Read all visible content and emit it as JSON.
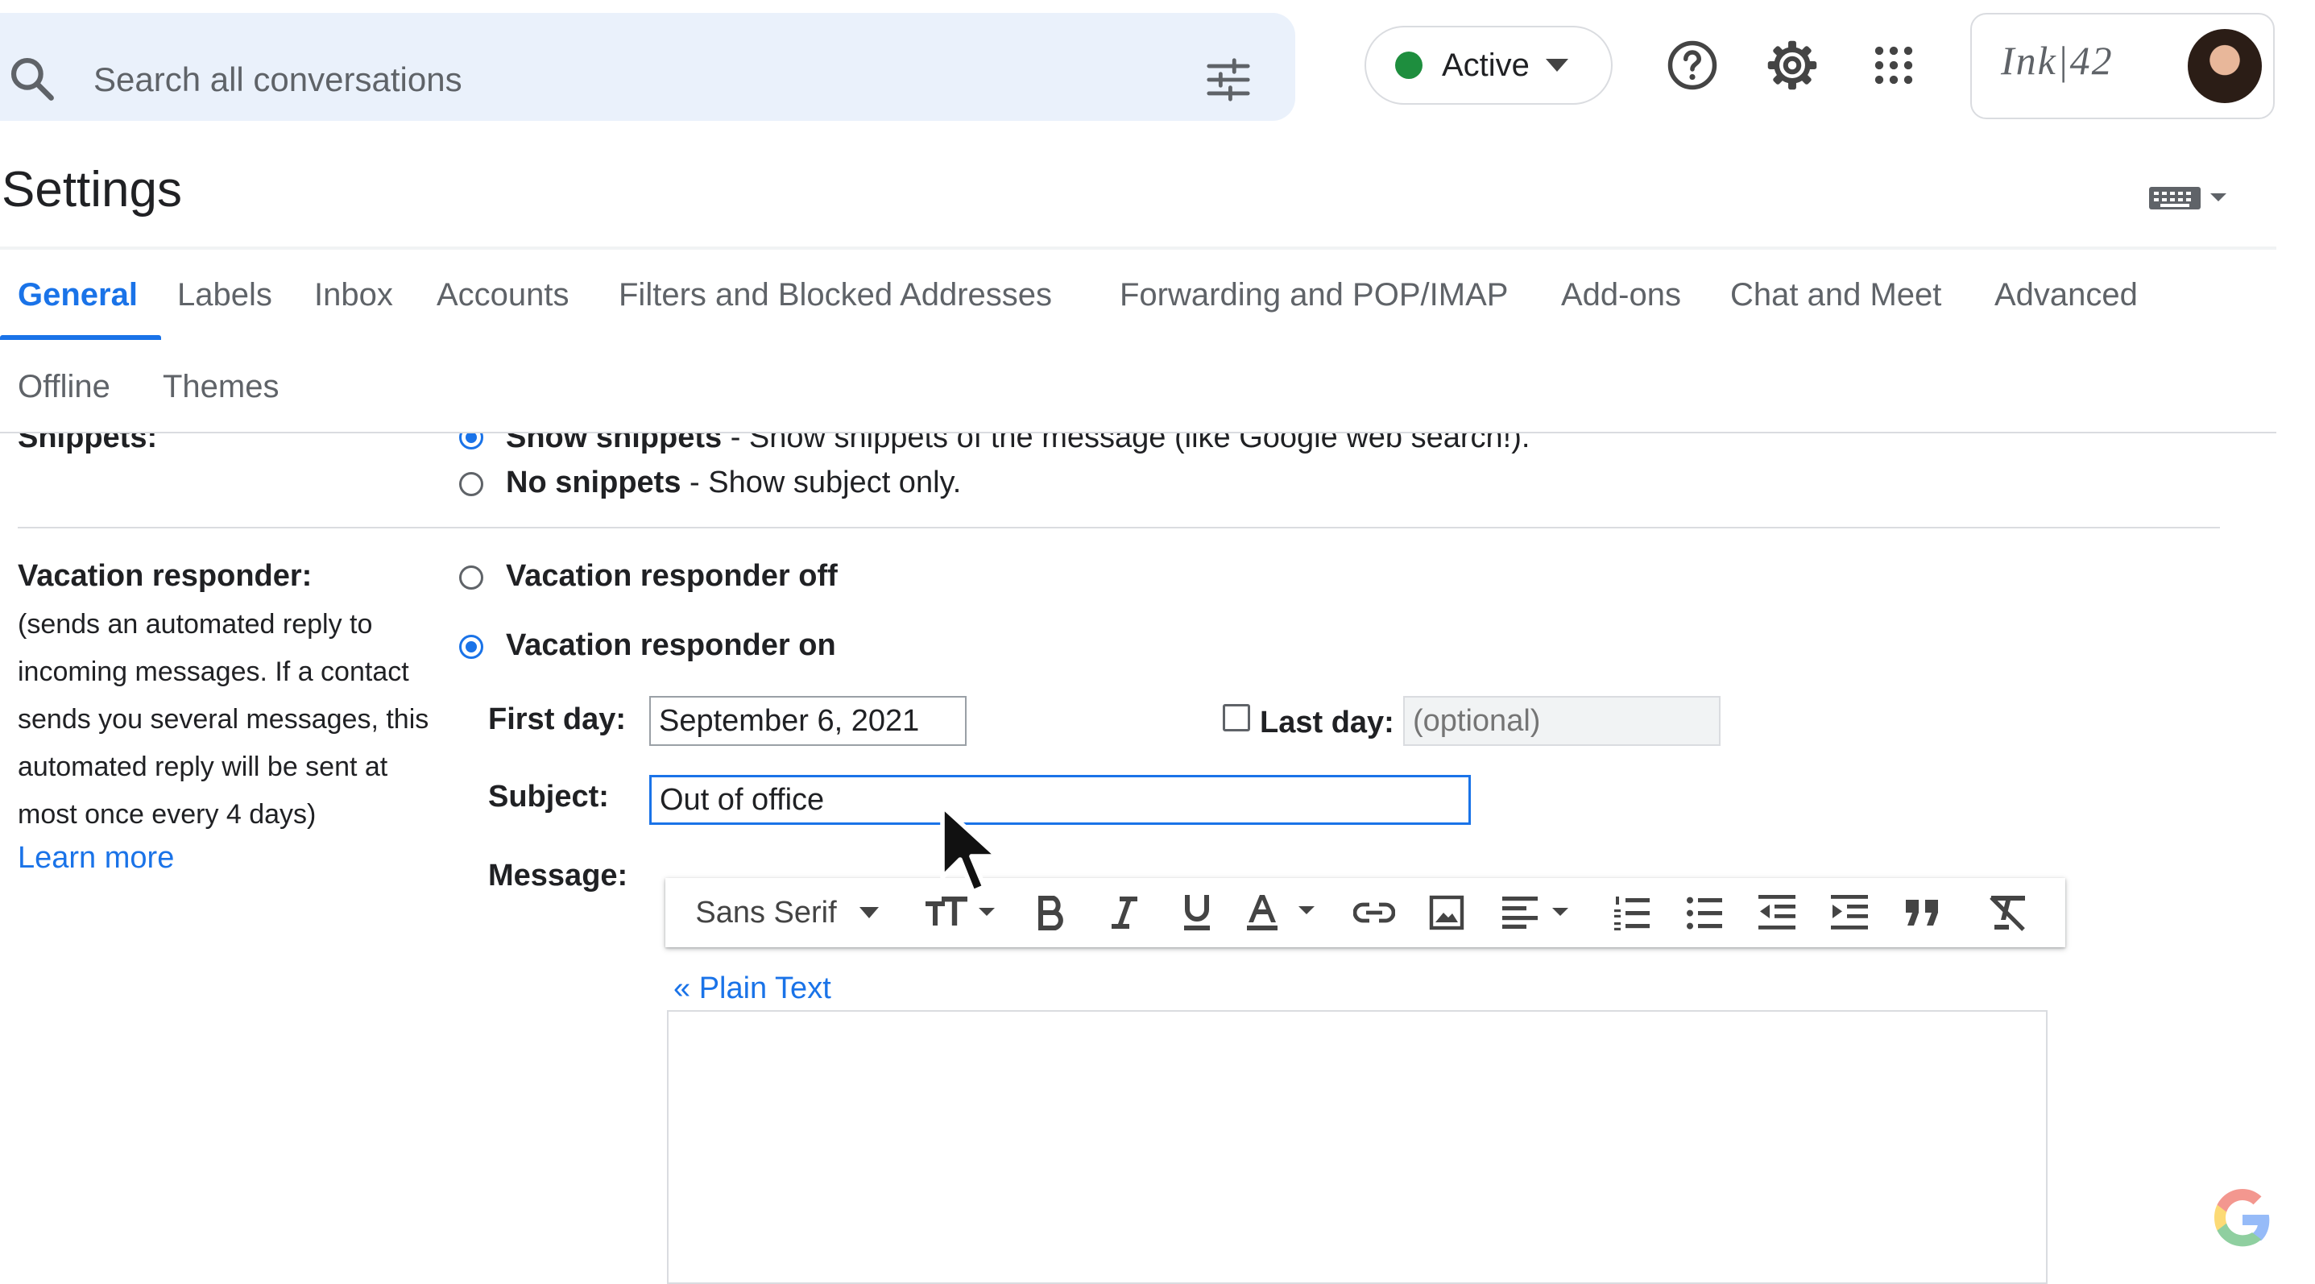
{
  "search": {
    "placeholder": "Search all conversations"
  },
  "status": {
    "label": "Active",
    "color": "#1e8e3e"
  },
  "account": {
    "brand_logo": "Ink|42"
  },
  "page": {
    "title": "Settings"
  },
  "tabs": {
    "row1": [
      "General",
      "Labels",
      "Inbox",
      "Accounts",
      "Filters and Blocked Addresses",
      "Forwarding and POP/IMAP",
      "Add-ons",
      "Chat and Meet",
      "Advanced"
    ],
    "row2": [
      "Offline",
      "Themes"
    ],
    "active": "General"
  },
  "snippets": {
    "label": "Snippets:",
    "option_show_bold": "Show snippets",
    "option_show_rest": " - Show snippets of the message (like Google web search!).",
    "option_none_bold": "No snippets",
    "option_none_rest": " - Show subject only.",
    "selected": "show"
  },
  "vacation": {
    "label": "Vacation responder:",
    "description_lines": [
      "(sends an automated reply to",
      "incoming messages. If a contact",
      "sends you several messages, this",
      "automated reply will be sent at",
      "most once every 4 days)"
    ],
    "learn_more": "Learn more",
    "option_off": "Vacation responder off",
    "option_on": "Vacation responder on",
    "selected": "on",
    "first_day_label": "First day:",
    "first_day_value": "September 6, 2021",
    "last_day_label": "Last day:",
    "last_day_placeholder": "(optional)",
    "last_day_checked": false,
    "subject_label": "Subject:",
    "subject_value": "Out of office",
    "message_label": "Message:",
    "plain_text_link": "« Plain Text"
  },
  "editor_toolbar": {
    "font": "Sans Serif",
    "buttons": [
      "font-size",
      "bold",
      "italic",
      "underline",
      "text-color",
      "link",
      "image",
      "align",
      "numbered-list",
      "bulleted-list",
      "indent-less",
      "indent-more",
      "quote",
      "remove-formatting"
    ]
  },
  "colors": {
    "accent": "#1a73e8",
    "search_bg": "#eaf1fb",
    "text": "#202124",
    "muted": "#5f6368"
  }
}
